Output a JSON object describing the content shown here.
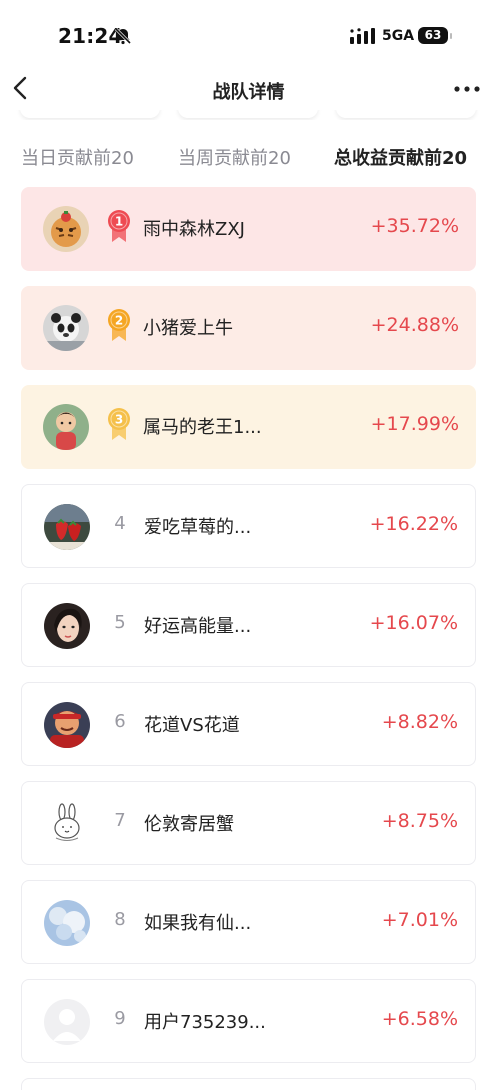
{
  "status_bar": {
    "time": "21:24",
    "network": "5GA",
    "battery": "63"
  },
  "header": {
    "title": "战队详情"
  },
  "tabs": [
    {
      "label": "当日贡献前20",
      "active": false
    },
    {
      "label": "当周贡献前20",
      "active": false
    },
    {
      "label": "总收益贡献前20",
      "active": true
    }
  ],
  "ranking": [
    {
      "rank": "1",
      "name": "雨中森林ZXJ",
      "return": "+35.72%",
      "medal": "red",
      "background": "#fde6e6",
      "avatar": "tiger-avatar"
    },
    {
      "rank": "2",
      "name": "小猪爱上牛",
      "return": "+24.88%",
      "medal": "orange",
      "background": "#fdece6",
      "avatar": "panda-avatar"
    },
    {
      "rank": "3",
      "name": "属马的老王1...",
      "return": "+17.99%",
      "medal": "yellow",
      "background": "#fdf3e2",
      "avatar": "boy-avatar"
    },
    {
      "rank": "4",
      "name": "爱吃草莓的...",
      "return": "+16.22%",
      "avatar": "strawberry-avatar"
    },
    {
      "rank": "5",
      "name": "好运高能量...",
      "return": "+16.07%",
      "avatar": "portrait-avatar"
    },
    {
      "rank": "6",
      "name": "花道VS花道",
      "return": "+8.82%",
      "avatar": "cartoon-avatar"
    },
    {
      "rank": "7",
      "name": "伦敦寄居蟹",
      "return": "+8.75%",
      "avatar": "rabbit-avatar"
    },
    {
      "rank": "8",
      "name": "如果我有仙...",
      "return": "+7.01%",
      "avatar": "sky-avatar"
    },
    {
      "rank": "9",
      "name": "用户735239...",
      "return": "+6.58%",
      "avatar": "default-avatar"
    }
  ],
  "colors": {
    "positive": "#e5484d",
    "medal_red": "#ee4b52",
    "medal_orange": "#f5a623",
    "medal_yellow": "#f5c04a"
  }
}
